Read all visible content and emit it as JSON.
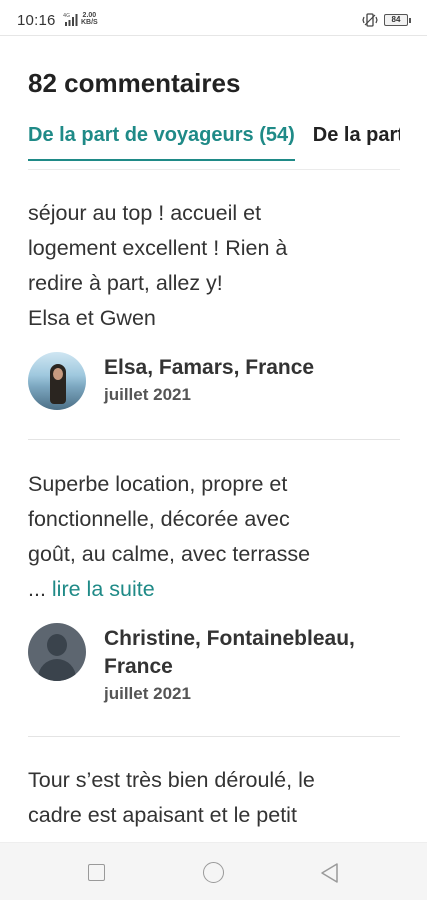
{
  "status_bar": {
    "time": "10:16",
    "network_speed_value": "2.00",
    "network_speed_unit": "KB/S",
    "battery_level": "84"
  },
  "page": {
    "title": "82 commentaires"
  },
  "tabs": [
    {
      "label": "De la part de voyageurs (54)",
      "active": true
    },
    {
      "label": "De la part d'hôtes",
      "active": false
    }
  ],
  "reviews": [
    {
      "text": "séjour au top ! accueil et\nlogement excellent ! Rien à\nredire à part, allez y!\nElsa et Gwen",
      "read_more": "",
      "author": "Elsa, Famars, France",
      "date": "juillet 2021",
      "avatar": "photo"
    },
    {
      "text": "Superbe location,  propre  et\nfonctionnelle, décorée avec\ngoût, au calme, avec terrasse\n... ",
      "read_more": "lire la suite",
      "author": "Christine, Fontainebleau, France",
      "date": "juillet 2021",
      "avatar": "default"
    },
    {
      "text": "Tour s’est très bien déroulé, le\ncadre est apaisant et le petit",
      "read_more": "",
      "author": "",
      "date": "",
      "avatar": ""
    }
  ],
  "colors": {
    "accent": "#1f8a87",
    "text": "#222222"
  },
  "icons": {
    "signal": "signal-icon",
    "vibrate": "vibrate-icon",
    "battery": "battery-icon",
    "nav_recent": "square-icon",
    "nav_home": "circle-icon",
    "nav_back": "back-triangle-icon"
  }
}
